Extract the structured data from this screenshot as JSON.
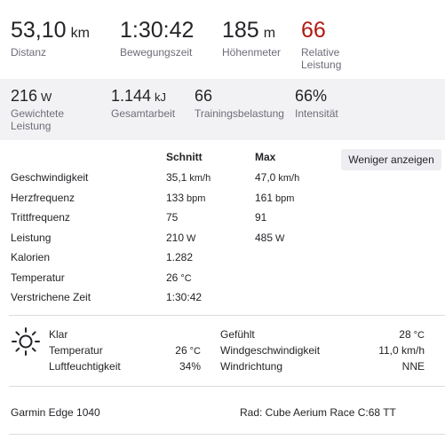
{
  "primary_stats": [
    {
      "value": "53,10",
      "unit": "km",
      "label": "Distanz"
    },
    {
      "value": "1:30:42",
      "unit": "",
      "label": "Bewegungszeit"
    },
    {
      "value": "185",
      "unit": "m",
      "label": "Höhenmeter"
    },
    {
      "value": "66",
      "unit": "",
      "label_line1": "Relative",
      "label_line2": "Leistung",
      "color": "#b01a10"
    }
  ],
  "secondary_stats": [
    {
      "value": "216",
      "unit": "W",
      "label_line1": "Gewichtete",
      "label_line2": "Leistung"
    },
    {
      "value": "1.144",
      "unit": "kJ",
      "label": "Gesamtarbeit"
    },
    {
      "value": "66",
      "unit": "",
      "label": "Trainingsbelastung"
    },
    {
      "value": "66%",
      "unit": "",
      "label": "Intensität"
    }
  ],
  "table": {
    "col_avg": "Schnitt",
    "col_max": "Max",
    "toggle_button": "Weniger anzeigen",
    "rows": [
      {
        "label": "Geschwindigkeit",
        "avg": "35,1",
        "avg_unit": "km/h",
        "max": "47,0",
        "max_unit": "km/h"
      },
      {
        "label": "Herzfrequenz",
        "avg": "133",
        "avg_unit": "bpm",
        "max": "161",
        "max_unit": "bpm"
      },
      {
        "label": "Trittfrequenz",
        "avg": "75",
        "avg_unit": "",
        "max": "91",
        "max_unit": ""
      },
      {
        "label": "Leistung",
        "avg": "210",
        "avg_unit": "W",
        "max": "485",
        "max_unit": "W"
      },
      {
        "label": "Kalorien",
        "avg": "1.282",
        "avg_unit": "",
        "max": "",
        "max_unit": ""
      },
      {
        "label": "Temperatur",
        "avg": "26",
        "avg_unit": "°C",
        "max": "",
        "max_unit": ""
      },
      {
        "label": "Verstrichene Zeit",
        "avg": "1:30:42",
        "avg_unit": "",
        "max": "",
        "max_unit": ""
      }
    ]
  },
  "weather": {
    "icon": "sun-icon",
    "condition": "Klar",
    "temperature_label": "Temperatur",
    "temperature_value": "26",
    "temperature_unit": "°C",
    "humidity_label": "Luftfeuchtigkeit",
    "humidity_value": "34%",
    "feels_like_label": "Gefühlt",
    "feels_like_value": "28",
    "feels_like_unit": "°C",
    "wind_speed_label": "Windgeschwindigkeit",
    "wind_speed_value": "11,0 km/h",
    "wind_dir_label": "Windrichtung",
    "wind_dir_value": "NNE"
  },
  "footer": {
    "device": "Garmin Edge 1040",
    "bike": "Rad: Cube Aerium Race C:68 TT"
  }
}
